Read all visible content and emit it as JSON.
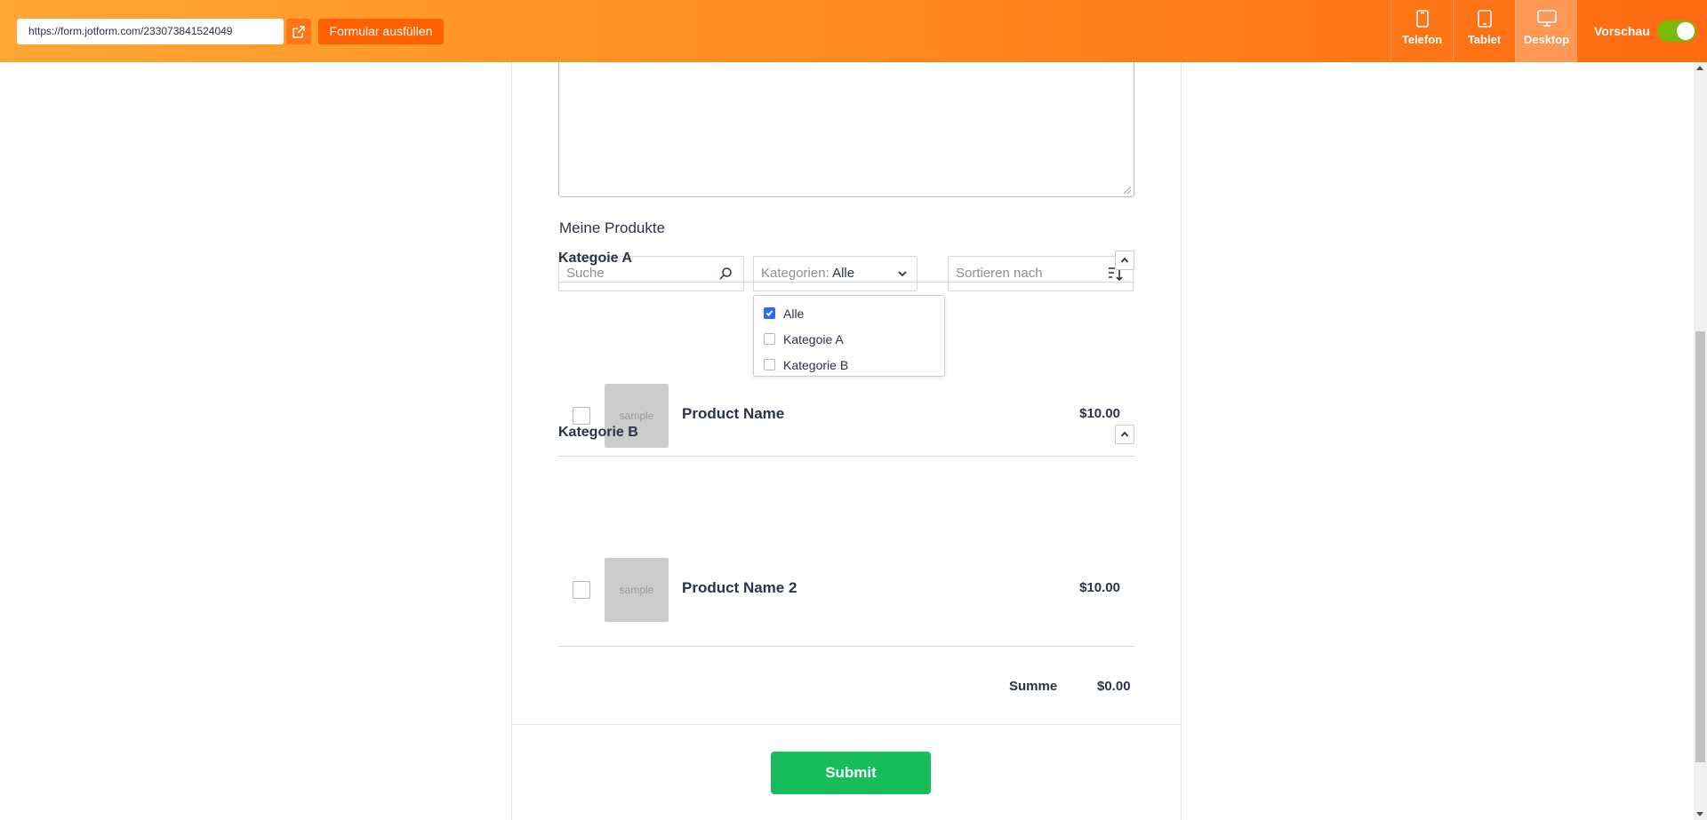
{
  "topbar": {
    "url": "https://form.jotform.com/233073841524049",
    "open_icon": "external-link-icon",
    "fill_button": "Formular ausfüllen",
    "devices": [
      {
        "label": "Telefon",
        "icon": "phone-icon",
        "active": false
      },
      {
        "label": "Tablet",
        "icon": "tablet-icon",
        "active": false
      },
      {
        "label": "Desktop",
        "icon": "desktop-icon",
        "active": true
      }
    ],
    "preview_label": "Vorschau",
    "preview_on": true
  },
  "products_widget": {
    "label": "Meine Produkte",
    "search_placeholder": "Suche",
    "category_prefix": "Kategorien: ",
    "category_value": "Alle",
    "sort_placeholder": "Sortieren nach",
    "dropdown_options": [
      {
        "label": "Alle",
        "checked": true
      },
      {
        "label": "Kategoie A",
        "checked": false
      },
      {
        "label": "Kategorie B",
        "checked": false
      }
    ],
    "categories": [
      {
        "title": "Kategoie A",
        "products": [
          {
            "name": "Product Name",
            "price": "$10.00",
            "thumb": "sample"
          }
        ]
      },
      {
        "title": "Kategorie B",
        "products": [
          {
            "name": "Product Name 2",
            "price": "$10.00",
            "thumb": "sample"
          }
        ]
      }
    ],
    "total_label": "Summe",
    "total_value": "$0.00"
  },
  "submit_label": "Submit",
  "colors": {
    "brand_orange": "#ff6100",
    "submit_green": "#18bd5b",
    "checkbox_blue": "#2e69ff",
    "toggle_green": "#78bb07"
  }
}
